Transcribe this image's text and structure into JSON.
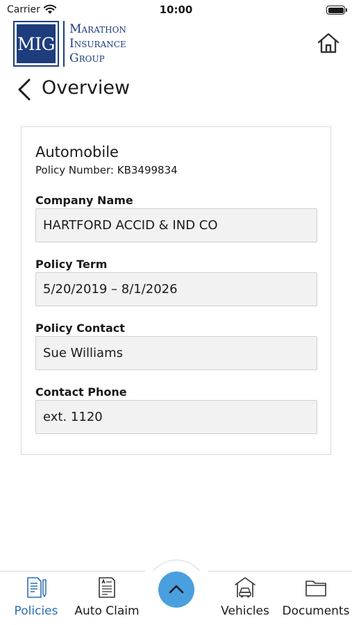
{
  "status_bar": {
    "carrier": "Carrier",
    "time": "10:00"
  },
  "brand": {
    "logo_initials": "MIG",
    "name_lines": [
      "Marathon",
      "Insurance",
      "Group"
    ],
    "color": "#1d3d7c"
  },
  "header": {
    "title": "Overview",
    "back_icon": "chevron-left-icon",
    "home_icon": "home-icon"
  },
  "policy": {
    "type": "Automobile",
    "number_text": "Policy Number: KB3499834",
    "fields": [
      {
        "label": "Company Name",
        "value": "HARTFORD ACCID & IND CO"
      },
      {
        "label": "Policy Term",
        "value": "5/20/2019 – 8/1/2026"
      },
      {
        "label": "Policy Contact",
        "value": "Sue Williams"
      },
      {
        "label": "Contact Phone",
        "value": "ext. 1120"
      }
    ]
  },
  "tab_bar": {
    "active": "Policies",
    "active_color": "#2a6fb5",
    "fab_color": "#4a9fdf",
    "fab_icon": "chevron-up-icon",
    "tabs": [
      {
        "label": "Policies",
        "icon": "policy-document-icon"
      },
      {
        "label": "Auto Claim",
        "icon": "auto-claim-form-icon"
      },
      {
        "label": "Vehicles",
        "icon": "garage-car-icon"
      },
      {
        "label": "Documents",
        "icon": "folder-icon"
      }
    ]
  }
}
